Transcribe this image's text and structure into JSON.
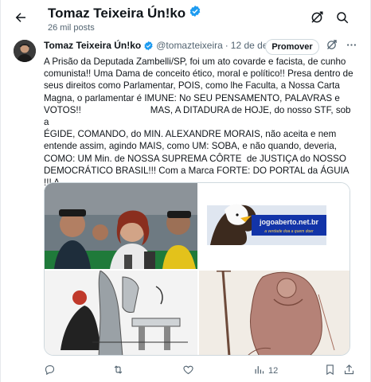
{
  "header": {
    "title": "Tomaz Teixeira Ún!ko",
    "posts_count": "26 mil posts",
    "icons": [
      "back-arrow-icon",
      "no-notifications-icon",
      "search-icon"
    ]
  },
  "tweet": {
    "author_name": "Tomaz Teixeira Ún!ko",
    "handle": "@tomazteixeira",
    "separator": "·",
    "date": "12 de dez",
    "promote_label": "Promover",
    "text": "A Prisão da Deputada Zambelli/SP, foi um ato covarde e facista, de cunho\ncomunista!! Uma Dama de conceito ético, moral e político!! Presa dentro de\nseus direitos como Parlamentar, POIS, como lhe Faculta, a Nossa Carta\nMagna, o parlamentar é IMUNE: No SEU PENSAMENTO, PALAVRAS e\nVOTOS!!                           MAS, A DITADURA de HOJE, do nosso STF, sob a\nÉGIDE, COMANDO, do MIN. ALEXANDRE MORAIS, não aceita e nem\nentende assim, agindo MAIS, como UM: SOBA, e não quando, deveria,\nCOMO: UM Min. de NOSSA SUPREMA CÔRTE  de JUSTIÇA do NOSSO\nDEMOCRÁTICO BRASIL!!! Com a Marca FORTE: DO PORTAL da ÁGUIA !!! A\nVERDADE: DOA, à Quem DOEERR!!!",
    "media": {
      "logo_text": "jogoaberto.net.br",
      "logo_subtext": "a verdade doa a quem doer"
    },
    "actions": {
      "reply_count": "",
      "retweet_count": "",
      "like_count": "",
      "views_count": "12"
    }
  },
  "colors": {
    "accent": "#1d9bf0",
    "text_primary": "#0f1419",
    "text_secondary": "#536471",
    "border": "#cfd9de"
  }
}
